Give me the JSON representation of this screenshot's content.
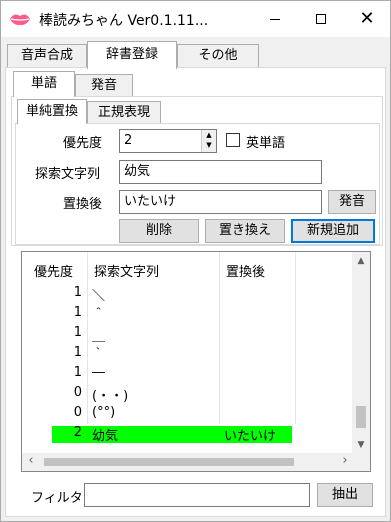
{
  "window": {
    "title": "棒読みちゃん Ver0.1.11...",
    "brand_color": "#ff5c8a"
  },
  "main_tabs": [
    "音声合成",
    "辞書登録",
    "その他"
  ],
  "sub_tabs": [
    "単語",
    "発音"
  ],
  "inner_tabs": [
    "単純置換",
    "正規表現"
  ],
  "form": {
    "priority_label": "優先度",
    "priority_value": "2",
    "english_word_label": "英単語",
    "search_label": "探索文字列",
    "search_value": "幼気",
    "replace_label": "置換後",
    "replace_value": "いたいけ",
    "pronounce_button": "発音",
    "delete_button": "削除",
    "replace_button": "置き換え",
    "add_button": "新規追加"
  },
  "list": {
    "columns": [
      "優先度",
      "探索文字列",
      "置換後"
    ],
    "rows": [
      {
        "priority": "1",
        "search": "＼",
        "replace": ""
      },
      {
        "priority": "1",
        "search": "＾",
        "replace": ""
      },
      {
        "priority": "1",
        "search": "＿",
        "replace": ""
      },
      {
        "priority": "1",
        "search": "｀",
        "replace": ""
      },
      {
        "priority": "1",
        "search": "―",
        "replace": ""
      },
      {
        "priority": "0",
        "search": "(・・)",
        "replace": ""
      },
      {
        "priority": "0",
        "search": "(°°)",
        "replace": ""
      },
      {
        "priority": "2",
        "search": "幼気",
        "replace": "いたいけ"
      }
    ],
    "highlight_color": "#00ff00"
  },
  "filter": {
    "label": "フィルタ",
    "value": "",
    "extract_button": "抽出"
  }
}
